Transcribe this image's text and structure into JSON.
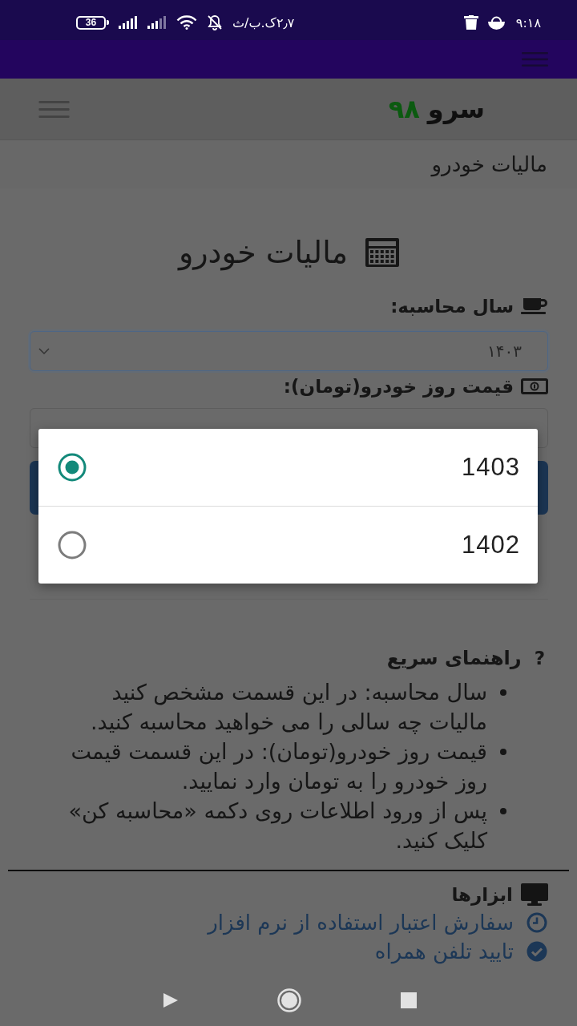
{
  "status_bar": {
    "battery": "36",
    "network_speed": "۲٫۷ک.ب/ث",
    "time": "۹:۱۸"
  },
  "header": {
    "brand_name": "سرو",
    "brand_number": "۹۸"
  },
  "breadcrumb": "مالیات خودرو",
  "form": {
    "title": "مالیات خودرو",
    "fields": [
      {
        "kind": "select",
        "label": "سال محاسبه:",
        "value": "۱۴۰۳"
      },
      {
        "kind": "input",
        "label": "قیمت روز خودرو(تومان):"
      }
    ]
  },
  "dialog": {
    "options": [
      {
        "label": "1403",
        "selected": true
      },
      {
        "label": "1402",
        "selected": false
      }
    ]
  },
  "help": {
    "icon": "?",
    "title": "راهنمای سریع",
    "items": [
      "سال محاسبه: در این قسمت مشخص کنید مالیات چه سالی را می خواهید محاسبه کنید.",
      "قیمت روز خودرو(تومان): در این قسمت قیمت روز خودرو را به تومان وارد نمایید.",
      "پس از ورود اطلاعات روی دکمه «محاسبه کن» کلیک کنید."
    ]
  },
  "tools": {
    "title": "ابزارها",
    "links": [
      "سفارش اعتبار استفاده از نرم افزار",
      "تایید تلفن همراه"
    ]
  }
}
